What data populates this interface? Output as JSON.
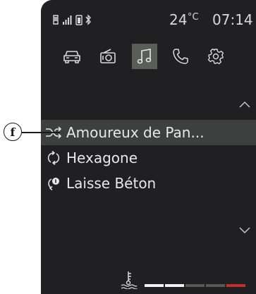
{
  "status": {
    "temperature": "24",
    "temperature_unit": "°C",
    "time": "07:14"
  },
  "tabs": [
    {
      "icon": "car-icon",
      "active": false
    },
    {
      "icon": "radio-icon",
      "active": false
    },
    {
      "icon": "music-note-icon",
      "active": true
    },
    {
      "icon": "phone-icon",
      "active": false
    },
    {
      "icon": "gear-icon",
      "active": false
    }
  ],
  "tracks": [
    {
      "title": "Amoureux de Pan...",
      "mode_icon": "shuffle-icon",
      "selected": true
    },
    {
      "title": "Hexagone",
      "mode_icon": "repeat-icon",
      "selected": false
    },
    {
      "title": "Laisse Béton",
      "mode_icon": "repeat-one-icon",
      "selected": false
    }
  ],
  "callout": {
    "label": "f"
  },
  "colors": {
    "screen_bg": "#202023",
    "active_tab": "#595e59",
    "selected_row": "#3e3f3f",
    "text": "#e8e8e8",
    "gauge_white": "#f2f2f2",
    "gauge_gray": "#555a55",
    "gauge_red": "#c0302a"
  }
}
